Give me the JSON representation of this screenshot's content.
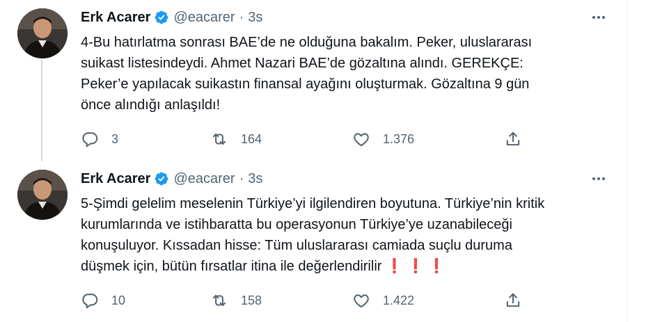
{
  "tweets": [
    {
      "author_name": "Erk Acarer",
      "handle": "@eacarer",
      "separator": "·",
      "time": "3s",
      "text_lines": [
        "4-Bu hatırlatma sonrası BAE’de ne olduğuna bakalım. Peker, uluslararası",
        "suikast listesindeydi. Ahmet Nazari BAE’de gözaltına alındı. GEREKÇE:",
        "Peker’e yapılacak suikastın finansal ayağını oluşturmak. Gözaltına 9 gün",
        "önce alındığı anlaşıldı!"
      ],
      "replies": "3",
      "retweets": "164",
      "likes": "1.376"
    },
    {
      "author_name": "Erk Acarer",
      "handle": "@eacarer",
      "separator": "·",
      "time": "3s",
      "text_lines": [
        "5-Şimdi gelelim meselenin Türkiye’yi ilgilendiren boyutuna. Türkiye’nin kritik",
        "kurumlarında ve istihbaratta bu operasyonun Türkiye’ye uzanabileceği",
        "konuşuluyor. Kıssadan hisse: Tüm uluslararası camiada suçlu duruma",
        "düşmek için, bütün fırsatlar itina ile değerlendirilir"
      ],
      "emoji": "❗ ❗ ❗",
      "replies": "10",
      "retweets": "158",
      "likes": "1.422"
    }
  ],
  "colors": {
    "text": "#0f1419",
    "secondary": "#536471",
    "verified": "#1d9bf0",
    "thread_line": "#cfd9de",
    "exclamation": "#d32f2f"
  },
  "icons": [
    "verified-badge-icon",
    "more-icon",
    "reply-icon",
    "retweet-icon",
    "like-icon",
    "share-icon"
  ]
}
